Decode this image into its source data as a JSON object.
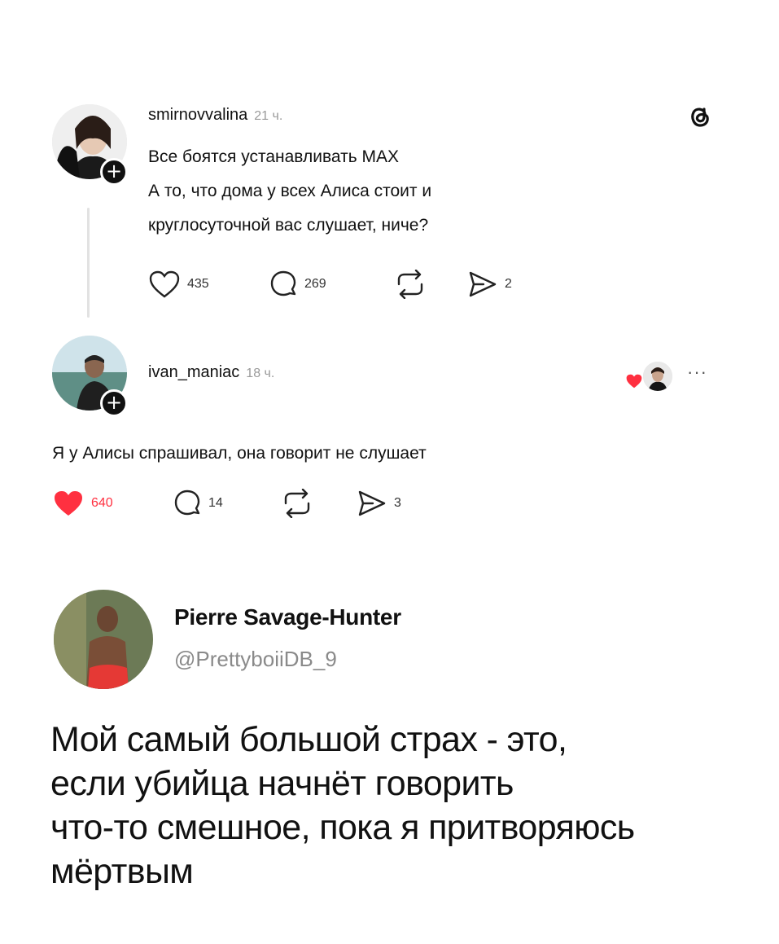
{
  "post1": {
    "username": "smirnovvalina",
    "time": "21 ч.",
    "lines": [
      "Все боятся устанавливать MAX",
      "А то, что дома у всех Алиса стоит и",
      "круглосуточной вас слушает, ниче?"
    ],
    "likes": "435",
    "comments": "269",
    "shares": "2"
  },
  "post2": {
    "username": "ivan_maniac",
    "time": "18 ч.",
    "text": "Я у Алисы спрашивал, она говорит не слушает",
    "likes": "640",
    "comments": "14",
    "shares": "3",
    "more": "···"
  },
  "tweet": {
    "name": "Pierre Savage-Hunter",
    "handle": "@PrettyboiiDB_9",
    "lines": [
      "Мой самый большой страх - это,",
      "если убийца начнёт говорить",
      "что-то смешное, пока я притворяюсь",
      "мёртвым"
    ]
  },
  "icons": {
    "threads_logo": "threads-logo-icon",
    "like": "heart-icon",
    "comment": "comment-icon",
    "repost": "repost-icon",
    "share": "send-icon"
  },
  "colors": {
    "like_active": "#ff3040",
    "muted": "#9a9a9a"
  }
}
